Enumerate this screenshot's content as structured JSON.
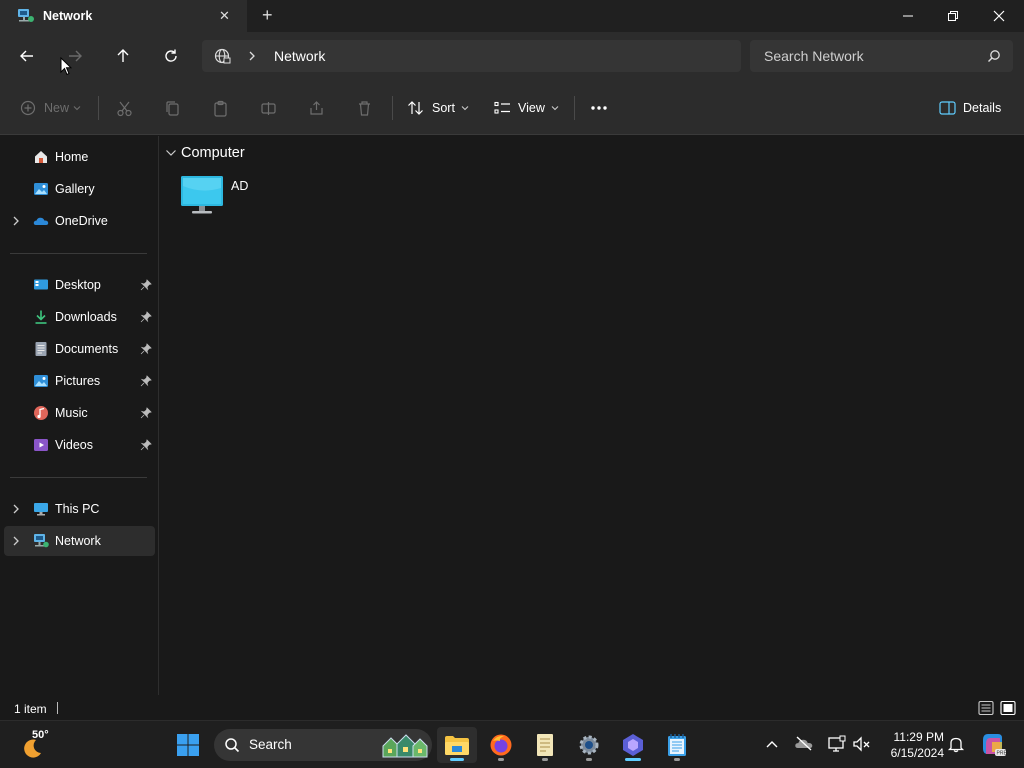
{
  "titlebar": {
    "tab_title": "Network",
    "new_tab_glyph": "+",
    "close_tab_glyph": "✕"
  },
  "navbar": {
    "address_segments": [
      "Network"
    ],
    "search_placeholder": "Search Network"
  },
  "toolbar": {
    "new_label": "New",
    "sort_label": "Sort",
    "view_label": "View",
    "details_label": "Details"
  },
  "sidebar": {
    "quick": [
      {
        "label": "Home",
        "icon": "home-icon"
      },
      {
        "label": "Gallery",
        "icon": "gallery-icon"
      },
      {
        "label": "OneDrive",
        "icon": "onedrive-icon"
      }
    ],
    "pinned": [
      {
        "label": "Desktop",
        "icon": "desktop-folder-icon"
      },
      {
        "label": "Downloads",
        "icon": "downloads-folder-icon"
      },
      {
        "label": "Documents",
        "icon": "documents-folder-icon"
      },
      {
        "label": "Pictures",
        "icon": "pictures-folder-icon"
      },
      {
        "label": "Music",
        "icon": "music-folder-icon"
      },
      {
        "label": "Videos",
        "icon": "videos-folder-icon"
      }
    ],
    "devices": [
      {
        "label": "This PC",
        "icon": "this-pc-icon"
      },
      {
        "label": "Network",
        "icon": "network-icon",
        "selected": true
      }
    ]
  },
  "content": {
    "group_header": "Computer",
    "items": [
      {
        "name": "AD",
        "icon": "computer-monitor-icon"
      }
    ]
  },
  "statusbar": {
    "item_count": "1 item"
  },
  "taskbar": {
    "weather_temp": "50°",
    "search_label": "Search",
    "clock_time": "11:29 PM",
    "clock_date": "6/15/2024"
  },
  "colors": {
    "accent": "#60cdff",
    "window_bg": "#191919",
    "chrome_bg": "#2c2c2c"
  }
}
